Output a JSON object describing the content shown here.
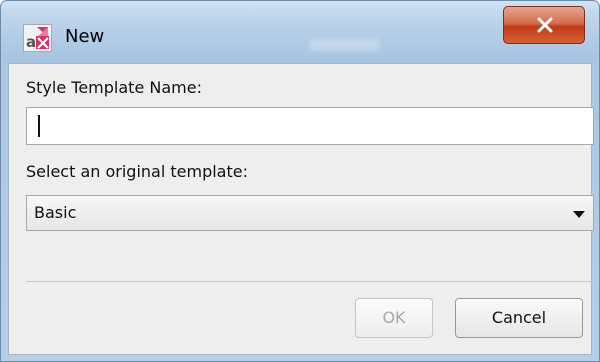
{
  "window": {
    "title": "New",
    "icon": "app-logo-icon",
    "close_icon": "close-icon"
  },
  "form": {
    "name_label": "Style Template Name:",
    "name_value": "",
    "template_label": "Select an original template:",
    "template_selected": "Basic"
  },
  "buttons": {
    "ok_label": "OK",
    "ok_enabled": false,
    "cancel_label": "Cancel"
  },
  "colors": {
    "close_button": "#c84a2a",
    "icon_accent": "#d6336c"
  }
}
